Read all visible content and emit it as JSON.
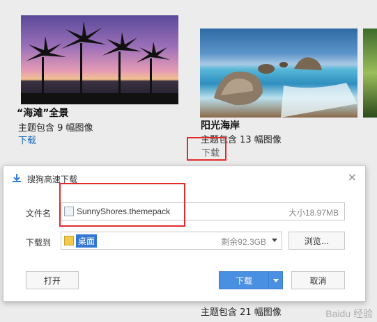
{
  "gallery": {
    "cards": [
      {
        "title": "“海滩”全景",
        "count": "主题包含 9 幅图像",
        "download": "下载"
      },
      {
        "title": "阳光海岸",
        "count": "主题包含 13 幅图像",
        "download": "下载"
      },
      {
        "count": "主题包含 21 幅图像"
      }
    ]
  },
  "dialog": {
    "title": "搜狗高速下载",
    "file_name_label": "文件名",
    "file_name": "SunnyShores.themepack",
    "file_size": "大小18.97MB",
    "save_to_label": "下载到",
    "save_to_value": "桌面",
    "free_space": "剩余92.3GB",
    "browse_label": "浏览...",
    "open_label": "打开",
    "download_label": "下载",
    "cancel_label": "取消",
    "close_glyph": "×"
  },
  "watermark": "Baidu 经验",
  "colors": {
    "accent": "#4a90e2",
    "link": "#1a6dbd",
    "annotation": "#e32a2a"
  }
}
